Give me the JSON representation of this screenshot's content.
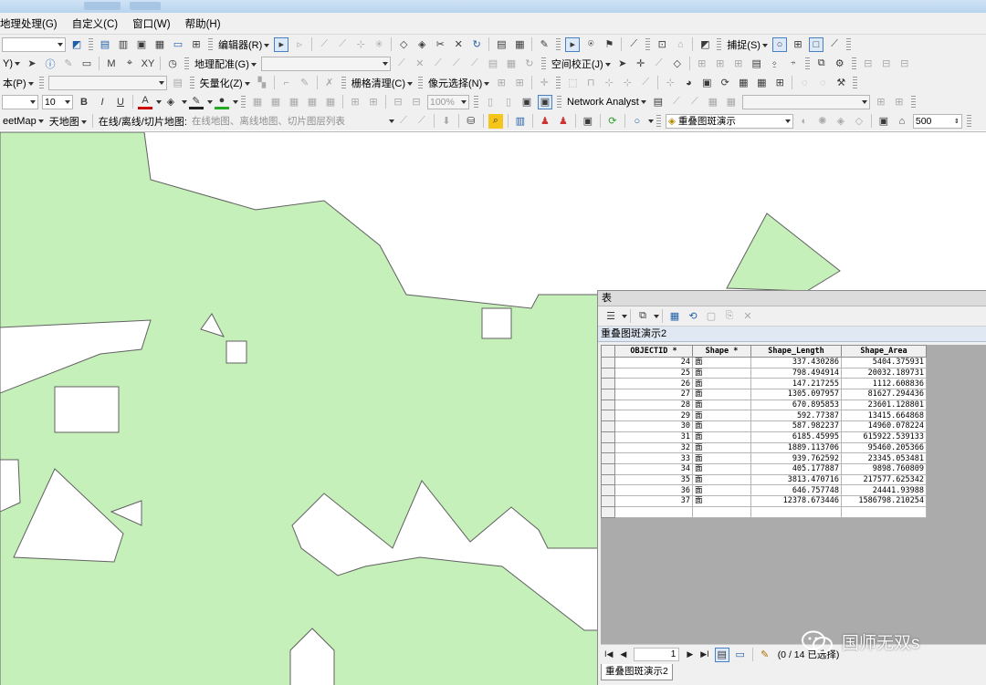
{
  "menubar": {
    "items": [
      "地理处理(G)",
      "自定义(C)",
      "窗口(W)",
      "帮助(H)"
    ]
  },
  "toolbar1": {
    "editor_label": "编辑器(R)",
    "snapping_label": "捕捉(S)"
  },
  "toolbar2": {
    "georef_label": "地理配准(G)",
    "spatial_adjust_label": "空间校正(J)"
  },
  "toolbar3": {
    "text_label": "本(P)",
    "vectorize_label": "矢量化(Z)",
    "raster_cleanup_label": "栅格清理(C)",
    "cell_select_label": "像元选择(N)",
    "zoom_value": "100%"
  },
  "toolbar4": {
    "font_size": "10",
    "bold": "B",
    "italic": "I",
    "underline": "U",
    "network_analyst_label": "Network Analyst"
  },
  "toolbar5": {
    "streetmap_label": "eetMap",
    "tianditu_label": "天地图",
    "online_label": "在线/离线/切片地图:",
    "online_hint": "在线地图、离线地图、切片图层列表",
    "layer_combo": "重叠图斑演示",
    "scale_value": "500"
  },
  "table_window": {
    "title": "表",
    "layer_tab": "重叠图斑演示2",
    "columns": [
      "OBJECTID *",
      "Shape *",
      "Shape_Length",
      "Shape_Area"
    ],
    "rows": [
      {
        "id": "24",
        "shape": "面",
        "length": "337.430286",
        "area": "5404.375931"
      },
      {
        "id": "25",
        "shape": "面",
        "length": "798.494914",
        "area": "20032.189731"
      },
      {
        "id": "26",
        "shape": "面",
        "length": "147.217255",
        "area": "1112.608836"
      },
      {
        "id": "27",
        "shape": "面",
        "length": "1305.097957",
        "area": "81627.294436"
      },
      {
        "id": "28",
        "shape": "面",
        "length": "670.895853",
        "area": "23601.128801"
      },
      {
        "id": "29",
        "shape": "面",
        "length": "592.77387",
        "area": "13415.664868"
      },
      {
        "id": "30",
        "shape": "面",
        "length": "587.982237",
        "area": "14960.078224"
      },
      {
        "id": "31",
        "shape": "面",
        "length": "6185.45995",
        "area": "615922.539133"
      },
      {
        "id": "32",
        "shape": "面",
        "length": "1889.113706",
        "area": "95460.205366"
      },
      {
        "id": "33",
        "shape": "面",
        "length": "939.762592",
        "area": "23345.053481"
      },
      {
        "id": "34",
        "shape": "面",
        "length": "405.177887",
        "area": "9898.760809"
      },
      {
        "id": "35",
        "shape": "面",
        "length": "3813.470716",
        "area": "217577.625342"
      },
      {
        "id": "36",
        "shape": "面",
        "length": "646.757748",
        "area": "24441.93988"
      },
      {
        "id": "37",
        "shape": "面",
        "length": "12378.673446",
        "area": "1586798.210254"
      }
    ],
    "nav": {
      "current_record": "1",
      "selection_status": "(0 / 14 已选择)"
    },
    "bottom_tab": "重叠图斑演示2"
  },
  "watermark": {
    "text": "国师无双s"
  },
  "colors": {
    "polygon_fill": "#c6f0b9",
    "polygon_stroke": "#606060"
  }
}
